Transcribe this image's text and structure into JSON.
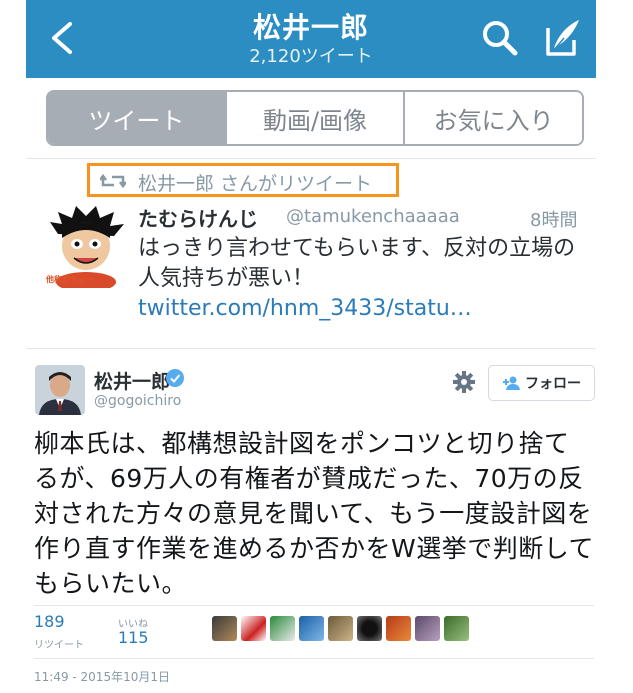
{
  "header": {
    "title": "松井一郎",
    "tweet_count": "2,120ツイート"
  },
  "tabs": [
    {
      "label": "ツイート",
      "active": true
    },
    {
      "label": "動画/画像",
      "active": false
    },
    {
      "label": "お気に入り",
      "active": false
    }
  ],
  "retweet_context": "松井一郎 さんがリツイート",
  "retweeted_tweet": {
    "name": "たむらけんじ",
    "handle": "@tamukenchaaaaa",
    "time": "8時間",
    "text": "はっきり言わせてもらいます、反対の立場の人気持ちが悪い！ ",
    "link": "twitter.com/hnm_3433/statu…",
    "avatar_caption": "他称がちゃー"
  },
  "tweet": {
    "name": "松井一郎",
    "handle": "@gogoichiro",
    "follow_label": "フォロー",
    "text": "柳本氏は、都構想設計図をポンコツと切り捨てるが、69万人の有権者が賛成だった、70万の反対された方々の意見を聞いて、もう一度設計図を作り直す作業を進めるか否かをW選挙で判断してもらいたい。",
    "retweets": "189",
    "retweets_label": "リツイート",
    "likes": "115",
    "likes_label": "いいね",
    "timestamp": "11:49 - 2015年10月1日"
  },
  "colors": {
    "header_bg": "#2b8dc1",
    "link": "#2b7bb9",
    "highlight": "#f7941d",
    "tab_active": "#a6adb4"
  }
}
